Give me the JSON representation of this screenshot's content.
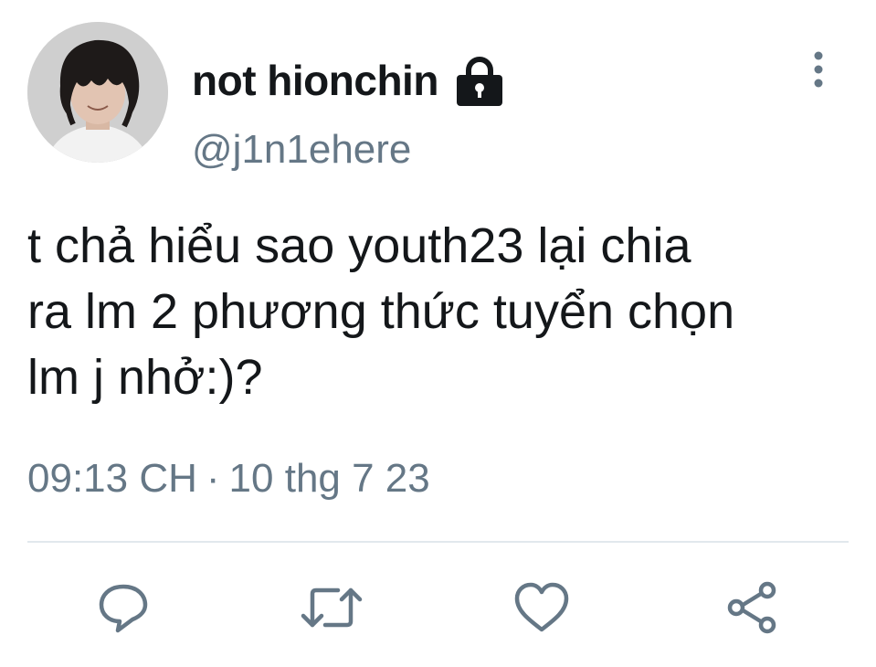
{
  "user": {
    "display_name": "not hionchin",
    "handle": "@j1n1ehere",
    "protected_icon": "lock-icon",
    "avatar_icon": "profile-photo"
  },
  "menu": {
    "icon": "more-vertical-icon"
  },
  "tweet": {
    "text": "t chả hiểu sao youth23 lại chia\nra lm 2 phương thức tuyển chọn\nlm j nhở:)?",
    "time": "09:13 CH",
    "separator": "·",
    "date": "10 thg 7 23"
  },
  "actions": [
    {
      "name": "reply",
      "icon": "reply-icon"
    },
    {
      "name": "retweet",
      "icon": "retweet-icon"
    },
    {
      "name": "like",
      "icon": "heart-icon"
    },
    {
      "name": "share",
      "icon": "share-icon"
    }
  ],
  "colors": {
    "text_primary": "#14171a",
    "text_secondary": "#657786",
    "divider": "#e1e8ed"
  }
}
